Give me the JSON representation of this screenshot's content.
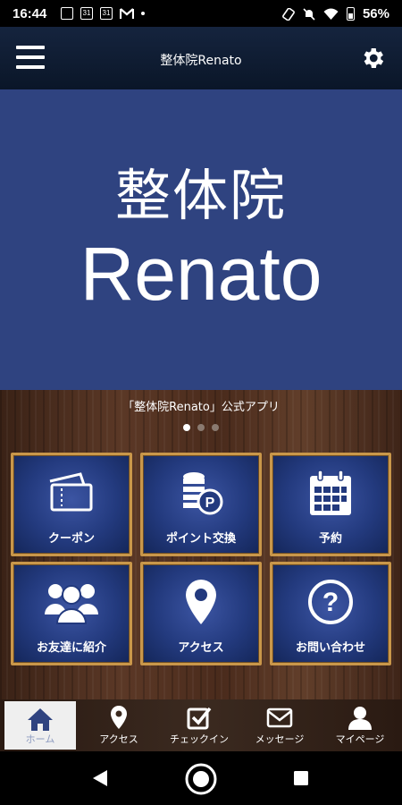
{
  "status_bar": {
    "time": "16:44",
    "calendar_day_1": "31",
    "calendar_day_2": "31",
    "battery": "56%"
  },
  "header": {
    "title": "整体院Renato"
  },
  "hero": {
    "line1": "整体院",
    "line2": "Renato"
  },
  "subtitle": "「整体院Renato」公式アプリ",
  "carousel": {
    "count": 3,
    "active": 0
  },
  "tiles": [
    {
      "label": "クーポン",
      "icon": "ticket-icon"
    },
    {
      "label": "ポイント交換",
      "icon": "coins-icon"
    },
    {
      "label": "予約",
      "icon": "calendar-icon"
    },
    {
      "label": "お友達に紹介",
      "icon": "users-icon"
    },
    {
      "label": "アクセス",
      "icon": "map-pin-icon"
    },
    {
      "label": "お問い合わせ",
      "icon": "question-icon"
    }
  ],
  "tabs": [
    {
      "label": "ホーム",
      "icon": "home-icon"
    },
    {
      "label": "アクセス",
      "icon": "map-pin-icon"
    },
    {
      "label": "チェックイン",
      "icon": "checkbox-icon"
    },
    {
      "label": "メッセージ",
      "icon": "mail-icon"
    },
    {
      "label": "マイページ",
      "icon": "person-icon"
    }
  ],
  "colors": {
    "hero_bg": "#2f4380",
    "tile_border": "#c9974a",
    "tile_bg": "#233a7e",
    "header_bg": "#0a1628",
    "active_tab_bg": "#efefef"
  }
}
